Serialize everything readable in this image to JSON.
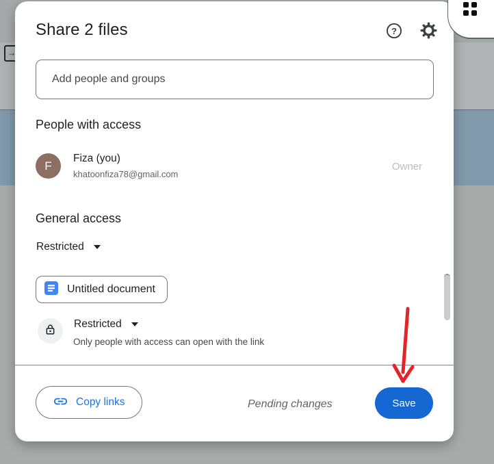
{
  "colors": {
    "accent-blue": "#1a73e8",
    "save-blue": "#1567d2",
    "avatar-brown": "#8d6e63",
    "docs-blue": "#4285f4",
    "arrow-red": "#e32428"
  },
  "dialog": {
    "title": "Share 2 files",
    "search": {
      "placeholder": "Add people and groups"
    },
    "people_section": {
      "heading": "People with access",
      "person": {
        "avatar_letter": "F",
        "name": "Fiza (you)",
        "email": "khatoonfiza78@gmail.com",
        "role": "Owner"
      }
    },
    "general_access": {
      "heading": "General access",
      "selected": "Restricted"
    },
    "file_chip": {
      "label": "Untitled document"
    },
    "link_access": {
      "selected": "Restricted",
      "description": "Only people with access can open with the link"
    },
    "footer": {
      "copy_links_label": "Copy links",
      "status": "Pending changes",
      "save_label": "Save"
    }
  }
}
